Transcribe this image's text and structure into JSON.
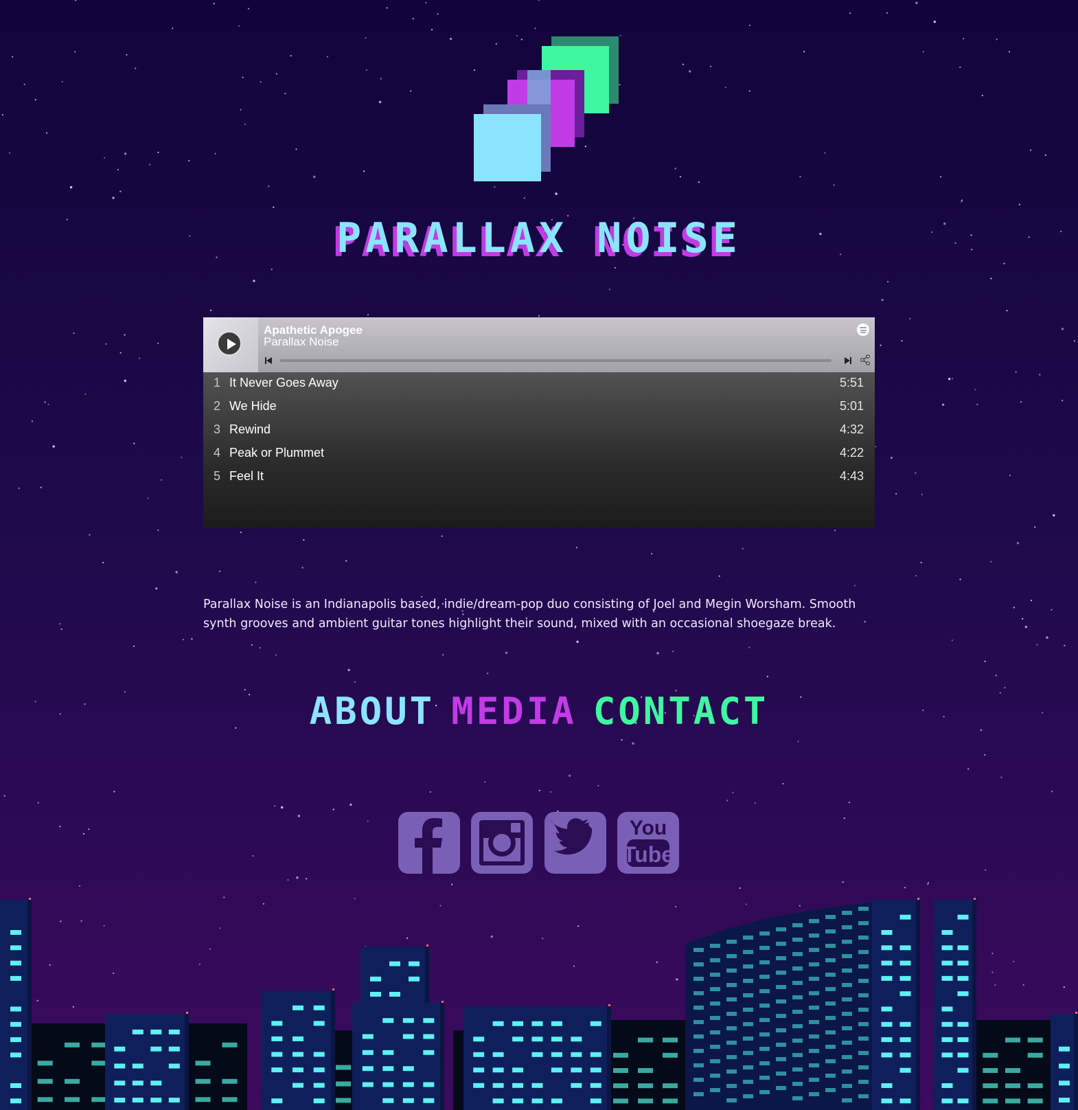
{
  "site": {
    "title": "PARALLAX NOISE"
  },
  "colors": {
    "cyan": "#8be4ff",
    "magenta": "#c13be6",
    "green": "#3ef7a0",
    "social": "#7a5fb6"
  },
  "player": {
    "album": "Apathetic Apogee",
    "artist": "Parallax Noise",
    "tracks": [
      {
        "num": "1",
        "name": "It Never Goes Away",
        "duration": "5:51"
      },
      {
        "num": "2",
        "name": "We Hide",
        "duration": "5:01"
      },
      {
        "num": "3",
        "name": "Rewind",
        "duration": "4:32"
      },
      {
        "num": "4",
        "name": "Peak or Plummet",
        "duration": "4:22"
      },
      {
        "num": "5",
        "name": "Feel It",
        "duration": "4:43"
      }
    ]
  },
  "bio": "Parallax Noise is an Indianapolis based, indie/dream-pop duo consisting of Joel and Megin Worsham. Smooth synth grooves and ambient guitar tones highlight their sound, mixed with an occasional shoegaze break.",
  "nav": {
    "about": "ABOUT",
    "media": "MEDIA",
    "contact": "CONTACT"
  },
  "social": [
    "facebook-icon",
    "instagram-icon",
    "twitter-icon",
    "youtube-icon"
  ],
  "youtube_text": {
    "top": "You",
    "bottom": "Tube"
  }
}
